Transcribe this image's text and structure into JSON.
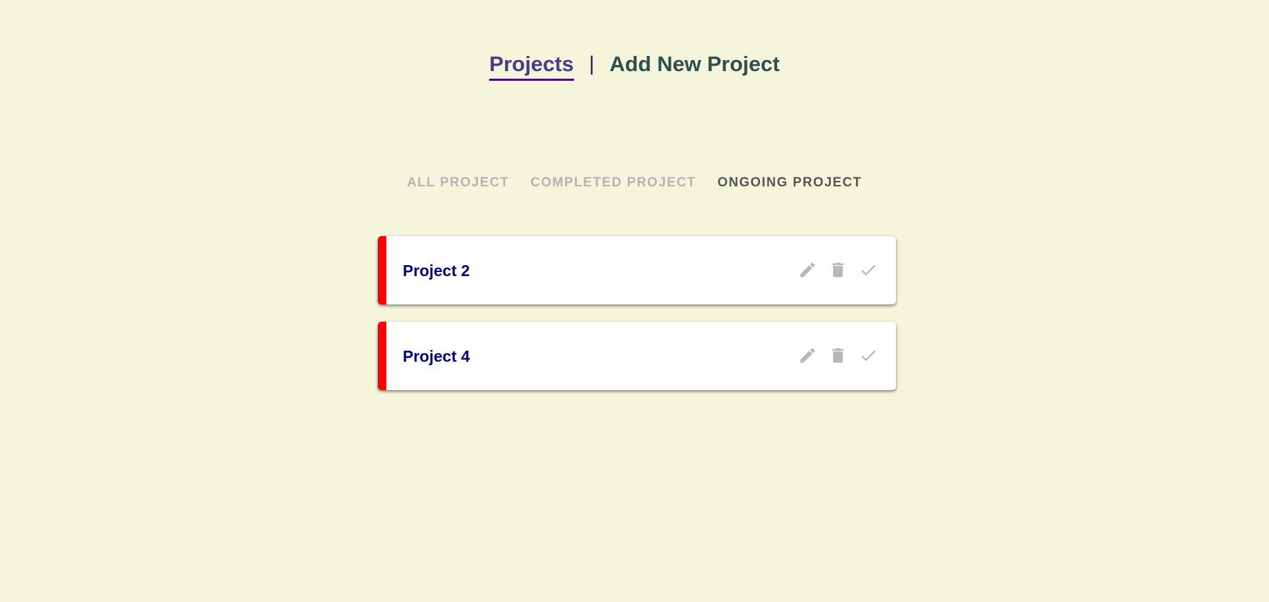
{
  "nav": {
    "projects_label": "Projects",
    "separator": "|",
    "add_label": "Add New Project"
  },
  "filters": {
    "all": "ALL PROJECT",
    "completed": "COMPLETED PROJECT",
    "ongoing": "ONGOING PROJECT",
    "selected": "ongoing"
  },
  "projects": [
    {
      "title": "Project 2",
      "status_color": "#ff0000",
      "icons": [
        "edit-icon",
        "delete-icon",
        "check-icon"
      ]
    },
    {
      "title": "Project 4",
      "status_color": "#ff0000",
      "icons": [
        "edit-icon",
        "delete-icon",
        "check-icon"
      ]
    }
  ],
  "colors": {
    "background": "#f5f5dc",
    "active_link": "#483d8b",
    "inactive_link": "#2f4f4f",
    "project_title": "#000080",
    "icon": "#b8b8b8"
  }
}
